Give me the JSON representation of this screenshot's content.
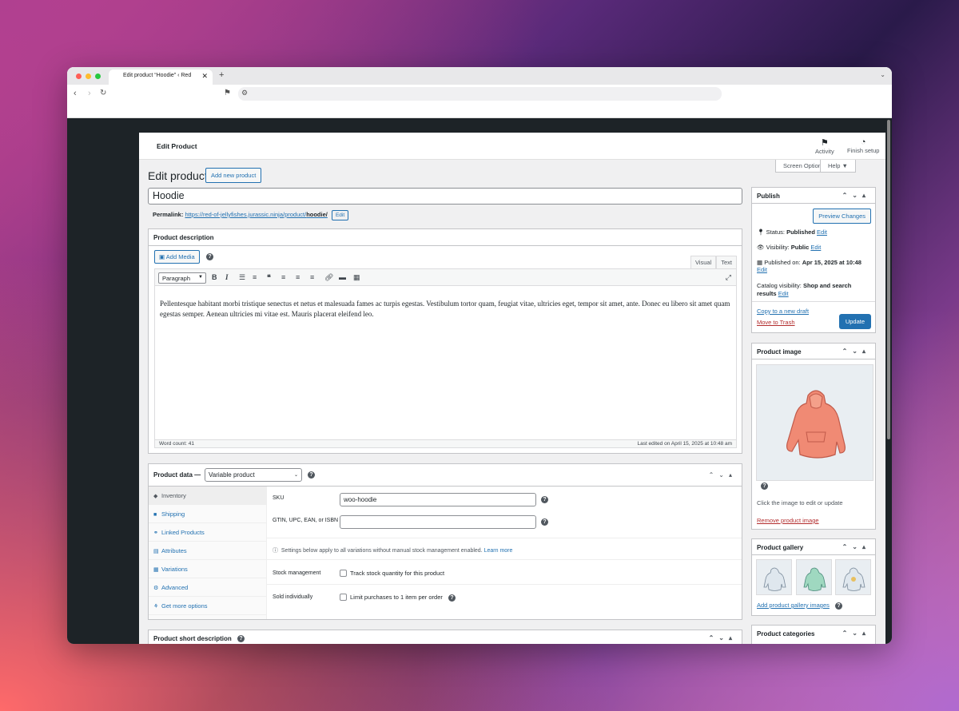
{
  "browser": {
    "tab_title": "Edit product “Hoodie” ‹ Red",
    "new_tab": "+",
    "close": "✕"
  },
  "admin": {
    "page_header": "Edit Product",
    "activity_label": "Activity",
    "finish_setup_label": "Finish setup",
    "screen_options": "Screen Options ▼",
    "help": "Help ▼"
  },
  "editor": {
    "heading": "Edit product",
    "add_new": "Add new product",
    "title_value": "Hoodie",
    "permalink_label": "Permalink:",
    "permalink_url": "https://red-of-jellyfishes.jurassic.ninja/product/",
    "permalink_slug": "hoodie/",
    "permalink_edit": "Edit"
  },
  "description": {
    "heading": "Product description",
    "add_media": "Add Media",
    "tab_visual": "Visual",
    "tab_text": "Text",
    "format_select": "Paragraph",
    "body": "Pellentesque habitant morbi tristique senectus et netus et malesuada fames ac turpis egestas. Vestibulum tortor quam, feugiat vitae, ultricies eget, tempor sit amet, ante. Donec eu libero sit amet quam egestas semper. Aenean ultricies mi vitae est. Mauris placerat eleifend leo.",
    "word_count": "Word count: 41",
    "last_edited": "Last edited on April 15, 2025 at 10:48 am"
  },
  "product_data": {
    "heading": "Product data —",
    "type_select": "Variable product",
    "tabs": [
      {
        "label": "Inventory",
        "icon": "◆"
      },
      {
        "label": "Shipping",
        "icon": "■"
      },
      {
        "label": "Linked Products",
        "icon": "⚭"
      },
      {
        "label": "Attributes",
        "icon": "▤"
      },
      {
        "label": "Variations",
        "icon": "▦"
      },
      {
        "label": "Advanced",
        "icon": "⚙"
      },
      {
        "label": "Get more options",
        "icon": "⚘"
      }
    ],
    "sku_label": "SKU",
    "sku_value": "woo-hoodie",
    "gtin_label": "GTIN, UPC, EAN, or ISBN",
    "gtin_value": "",
    "settings_note": "Settings below apply to all variations without manual stock management enabled.",
    "learn_more": "Learn more",
    "stock_label": "Stock management",
    "stock_checkbox": "Track stock quantity for this product",
    "sold_label": "Sold individually",
    "sold_checkbox": "Limit purchases to 1 item per order"
  },
  "short_description": {
    "heading": "Product short description"
  },
  "publish": {
    "heading": "Publish",
    "preview": "Preview Changes",
    "status_label": "Status:",
    "status_value": "Published",
    "visibility_label": "Visibility:",
    "visibility_value": "Public",
    "published_label": "Published on:",
    "published_value": "Apr 15, 2025 at 10:48",
    "catalog_label": "Catalog visibility:",
    "catalog_value_1": "Shop and search",
    "catalog_value_2": "results",
    "edit": "Edit",
    "copy_draft": "Copy to a new draft",
    "trash": "Move to Trash",
    "update": "Update"
  },
  "product_image": {
    "heading": "Product image",
    "hint": "Click the image to edit or update",
    "remove": "Remove product image"
  },
  "gallery": {
    "heading": "Product gallery",
    "add": "Add product gallery images"
  },
  "categories": {
    "heading": "Product categories"
  },
  "colors": {
    "primary": "#2271b1",
    "danger": "#b32d2e",
    "admin_bar": "#1d2327"
  }
}
